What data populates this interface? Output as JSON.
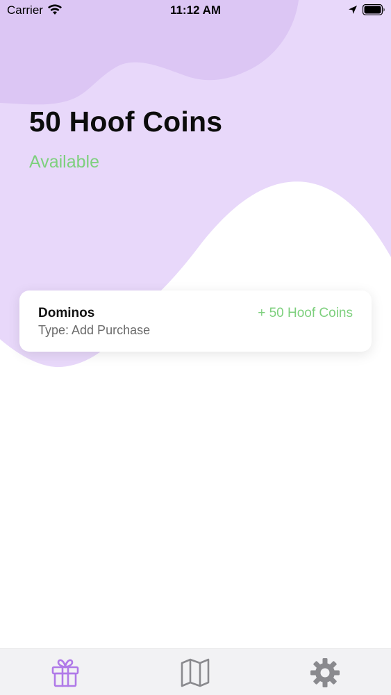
{
  "status_bar": {
    "carrier": "Carrier",
    "time": "11:12 AM"
  },
  "balance": {
    "title": "50 Hoof Coins",
    "status": "Available"
  },
  "transactions": [
    {
      "merchant": "Dominos",
      "type": "Type: Add Purchase",
      "amount": "+ 50 Hoof Coins"
    }
  ],
  "tab_bar": {
    "items": [
      {
        "icon": "gift-icon",
        "selected": true
      },
      {
        "icon": "map-icon",
        "selected": false
      },
      {
        "icon": "gear-icon",
        "selected": false
      }
    ]
  },
  "colors": {
    "wave_light": "#e7d6f9",
    "wave_dark": "#dcc7f5",
    "accent_green": "#7ed07e",
    "tab_selected": "#b07ae8",
    "tab_unselected": "#8a8a8e"
  }
}
